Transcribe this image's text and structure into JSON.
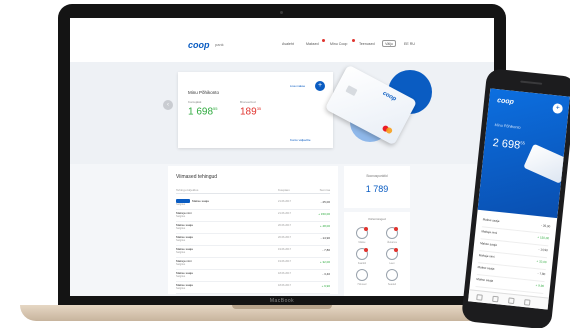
{
  "laptop": {
    "brand": "MacBook"
  },
  "nav": {
    "logo": "coop",
    "logo_sub": "pank",
    "items": [
      "Avaleht",
      "Maksed",
      "Minu Coop",
      "Teenused"
    ],
    "button": "Välju",
    "lang": "EE RU"
  },
  "hero": {
    "account_name": "Minu Põhikonto",
    "balance_label": "Kontojääk",
    "balance": "1 698",
    "balance_cents": "55",
    "second_label": "Broneeritud",
    "second_balance": "189",
    "second_cents": "35",
    "add_link": "Lisa makse",
    "account_link": "Konto väljavõte",
    "card_logo": "coop"
  },
  "transactions": {
    "title": "Viimased tehingud",
    "columns": [
      "Tehingu kirjeldus",
      "Kuupäev",
      "Summa"
    ],
    "rows": [
      {
        "name": "Makse saaja",
        "sub": "Selgitus",
        "date": "21.06.2017",
        "amount": "- 25,00",
        "type": "out"
      },
      {
        "name": "Maksja nimi",
        "sub": "Selgitus",
        "date": "21.06.2017",
        "amount": "+ 150,00",
        "type": "in"
      },
      {
        "name": "Makse saaja",
        "sub": "Selgitus",
        "date": "20.06.2017",
        "amount": "+ 48,00",
        "type": "in"
      },
      {
        "name": "Makse saaja",
        "sub": "Selgitus",
        "date": "20.06.2017",
        "amount": "- 14,90",
        "type": "out"
      },
      {
        "name": "Makse saaja",
        "sub": "Selgitus",
        "date": "19.06.2017",
        "amount": "- 7,80",
        "type": "out"
      },
      {
        "name": "Maksja nimi",
        "sub": "Selgitus",
        "date": "19.06.2017",
        "amount": "+ 32,00",
        "type": "in"
      },
      {
        "name": "Makse saaja",
        "sub": "Selgitus",
        "date": "18.06.2017",
        "amount": "- 3,40",
        "type": "out"
      },
      {
        "name": "Makse saaja",
        "sub": "Selgitus",
        "date": "18.06.2017",
        "amount": "+ 9,90",
        "type": "in"
      }
    ]
  },
  "bonus": {
    "label": "Boonuspunktid",
    "value": "1 789"
  },
  "quick": {
    "title": "Kiirtoimingud",
    "items": [
      "Makse",
      "Ülekanne",
      "Kaardid",
      "Laen",
      "Hoiused",
      "Seaded"
    ]
  },
  "phone": {
    "logo": "coop",
    "account": "Minu Põhikonto",
    "balance": "2 698",
    "cents": "55",
    "rows": [
      {
        "name": "Makse saaja",
        "amount": "- 25,00",
        "type": "out"
      },
      {
        "name": "Maksja nimi",
        "amount": "+ 150,00",
        "type": "in"
      },
      {
        "name": "Makse saaja",
        "amount": "- 14,90",
        "type": "out"
      },
      {
        "name": "Maksja nimi",
        "amount": "+ 32,00",
        "type": "in"
      },
      {
        "name": "Makse saaja",
        "amount": "- 7,80",
        "type": "out"
      },
      {
        "name": "Makse saaja",
        "amount": "+ 9,90",
        "type": "in"
      }
    ]
  },
  "colors": {
    "brand": "#0a5cc2",
    "positive": "#2eaa3e",
    "negative": "#e0332e"
  }
}
